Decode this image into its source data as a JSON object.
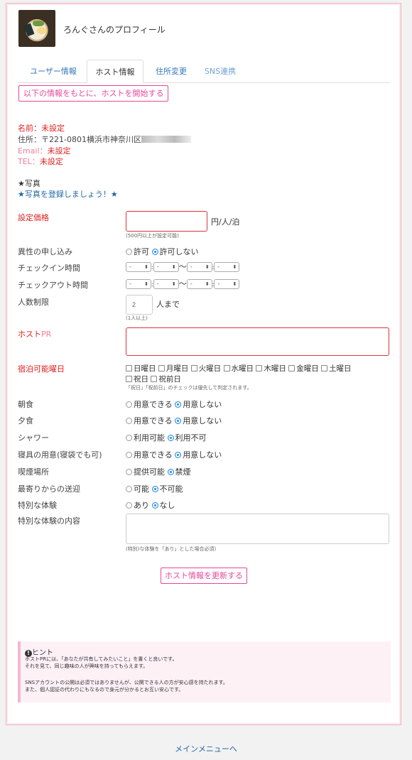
{
  "profile": {
    "title": "ろんぐさんのプロフィール"
  },
  "tabs": [
    {
      "label": "ユーザー情報"
    },
    {
      "label": "ホスト情報"
    },
    {
      "label": "住所変更"
    },
    {
      "label": "SNS連携"
    }
  ],
  "start_host_button": "以下の情報をもとに、ホストを開始する",
  "info": {
    "name_label": "名前：",
    "name_value": "未設定",
    "address_label": "住所：",
    "address_value": "〒221-0801横浜市神奈川区",
    "email_label": "Email：",
    "email_value": "未設定",
    "tel_label": "TEL：",
    "tel_value": "未設定"
  },
  "photo": {
    "heading": "★写真",
    "link": "★写真を登録しましょう！★"
  },
  "price": {
    "label": "設定価格",
    "value": "",
    "unit": "円/人/泊",
    "note": "(500円以上が設定可能)"
  },
  "opposite_sex": {
    "label": "異性の申し込み",
    "options": [
      "許可",
      "許可しない"
    ],
    "selected": 1
  },
  "checkin": {
    "label": "チェックイン時間",
    "sel_value": "-",
    "sep_colon": ":",
    "sep_range": "〜"
  },
  "checkout": {
    "label": "チェックアウト時間",
    "sel_value": "-"
  },
  "capacity": {
    "label": "人数制限",
    "value": "2",
    "unit": "人まで",
    "note": "(1人以上)"
  },
  "host_pr": {
    "label_main": "ホスト",
    "label_pr": "PR",
    "value": ""
  },
  "days": {
    "label": "宿泊可能曜日",
    "options": [
      "日曜日",
      "月曜日",
      "火曜日",
      "水曜日",
      "木曜日",
      "金曜日",
      "土曜日",
      "祝日",
      "祝前日"
    ],
    "note": "「祝日」「祝前日」のチェックは優先して判定されます。"
  },
  "breakfast": {
    "label": "朝食",
    "options": [
      "用意できる",
      "用意しない"
    ],
    "selected": 1
  },
  "dinner": {
    "label": "夕食",
    "options": [
      "用意できる",
      "用意しない"
    ],
    "selected": 1
  },
  "shower": {
    "label": "シャワー",
    "options": [
      "利用可能",
      "利用不可"
    ],
    "selected": 1
  },
  "bedding": {
    "label": "寝具の用意(寝袋でも可)",
    "options": [
      "用意できる",
      "用意しない"
    ],
    "selected": 1
  },
  "smoking": {
    "label": "喫煙場所",
    "options": [
      "提供可能",
      "禁煙"
    ],
    "selected": 1
  },
  "pickup": {
    "label": "最寄りからの送迎",
    "options": [
      "可能",
      "不可能"
    ],
    "selected": 1
  },
  "special": {
    "label": "特別な体験",
    "options": [
      "あり",
      "なし"
    ],
    "selected": 1
  },
  "special_detail": {
    "label": "特別な体験の内容",
    "value": "",
    "note": "(特別)な体験を「あり」とした場合必須)"
  },
  "update_button": "ホスト情報を更新する",
  "hint": {
    "title": "ヒント",
    "line1": "ホストPRには、「あなたが共有してみたいこと」を書くと良いです。",
    "line2": "それを見て、同じ趣味の人が興味を持ってもらえます。",
    "line3": "SNSアカウントの公開は必須ではありませんが、公開できる人の方が安心感を持たれます。",
    "line4": "また、個人認証の代わりにもなるので身元が分かるとお互い安心です。"
  },
  "footer": {
    "main_menu": "メインメニューへ"
  },
  "colors": {
    "accent_pink": "#e6489a",
    "required_red": "#e02020",
    "link_blue": "#2266aa",
    "radio_blue": "#1e88e5"
  }
}
